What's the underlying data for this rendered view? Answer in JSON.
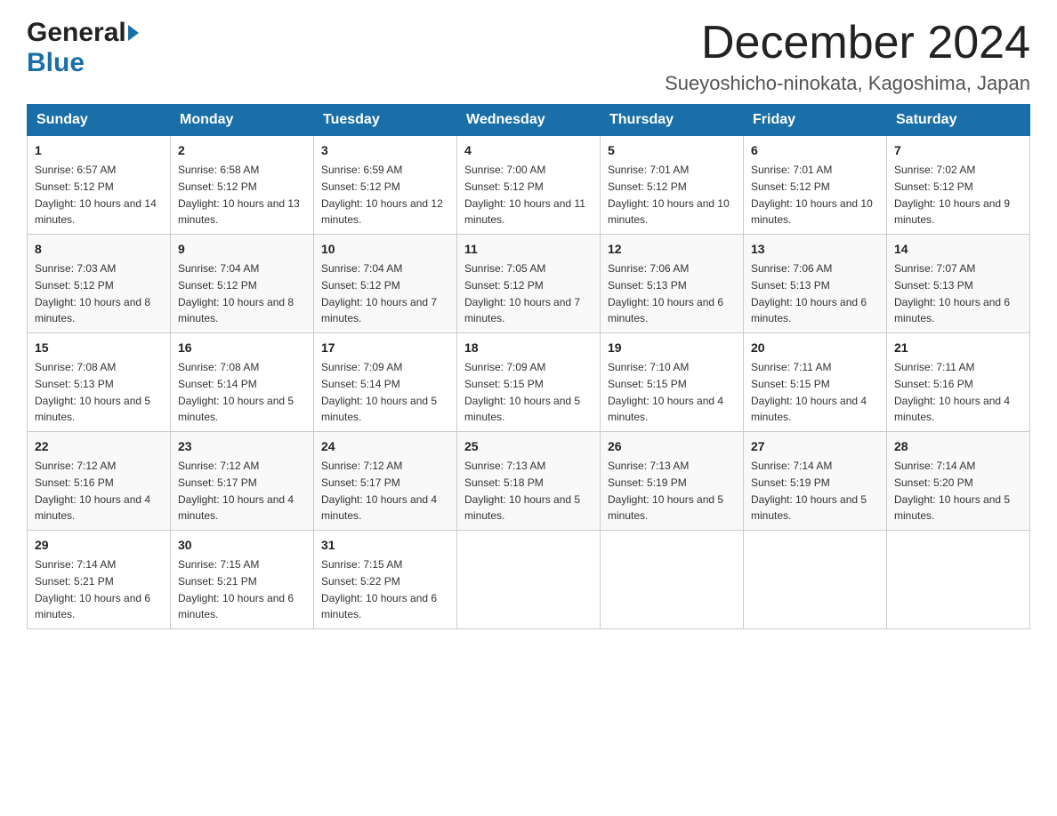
{
  "header": {
    "logo_general": "General",
    "logo_blue": "Blue",
    "month_title": "December 2024",
    "location": "Sueyoshicho-ninokata, Kagoshima, Japan"
  },
  "weekdays": [
    "Sunday",
    "Monday",
    "Tuesday",
    "Wednesday",
    "Thursday",
    "Friday",
    "Saturday"
  ],
  "weeks": [
    [
      {
        "day": "1",
        "sunrise": "6:57 AM",
        "sunset": "5:12 PM",
        "daylight": "10 hours and 14 minutes."
      },
      {
        "day": "2",
        "sunrise": "6:58 AM",
        "sunset": "5:12 PM",
        "daylight": "10 hours and 13 minutes."
      },
      {
        "day": "3",
        "sunrise": "6:59 AM",
        "sunset": "5:12 PM",
        "daylight": "10 hours and 12 minutes."
      },
      {
        "day": "4",
        "sunrise": "7:00 AM",
        "sunset": "5:12 PM",
        "daylight": "10 hours and 11 minutes."
      },
      {
        "day": "5",
        "sunrise": "7:01 AM",
        "sunset": "5:12 PM",
        "daylight": "10 hours and 10 minutes."
      },
      {
        "day": "6",
        "sunrise": "7:01 AM",
        "sunset": "5:12 PM",
        "daylight": "10 hours and 10 minutes."
      },
      {
        "day": "7",
        "sunrise": "7:02 AM",
        "sunset": "5:12 PM",
        "daylight": "10 hours and 9 minutes."
      }
    ],
    [
      {
        "day": "8",
        "sunrise": "7:03 AM",
        "sunset": "5:12 PM",
        "daylight": "10 hours and 8 minutes."
      },
      {
        "day": "9",
        "sunrise": "7:04 AM",
        "sunset": "5:12 PM",
        "daylight": "10 hours and 8 minutes."
      },
      {
        "day": "10",
        "sunrise": "7:04 AM",
        "sunset": "5:12 PM",
        "daylight": "10 hours and 7 minutes."
      },
      {
        "day": "11",
        "sunrise": "7:05 AM",
        "sunset": "5:12 PM",
        "daylight": "10 hours and 7 minutes."
      },
      {
        "day": "12",
        "sunrise": "7:06 AM",
        "sunset": "5:13 PM",
        "daylight": "10 hours and 6 minutes."
      },
      {
        "day": "13",
        "sunrise": "7:06 AM",
        "sunset": "5:13 PM",
        "daylight": "10 hours and 6 minutes."
      },
      {
        "day": "14",
        "sunrise": "7:07 AM",
        "sunset": "5:13 PM",
        "daylight": "10 hours and 6 minutes."
      }
    ],
    [
      {
        "day": "15",
        "sunrise": "7:08 AM",
        "sunset": "5:13 PM",
        "daylight": "10 hours and 5 minutes."
      },
      {
        "day": "16",
        "sunrise": "7:08 AM",
        "sunset": "5:14 PM",
        "daylight": "10 hours and 5 minutes."
      },
      {
        "day": "17",
        "sunrise": "7:09 AM",
        "sunset": "5:14 PM",
        "daylight": "10 hours and 5 minutes."
      },
      {
        "day": "18",
        "sunrise": "7:09 AM",
        "sunset": "5:15 PM",
        "daylight": "10 hours and 5 minutes."
      },
      {
        "day": "19",
        "sunrise": "7:10 AM",
        "sunset": "5:15 PM",
        "daylight": "10 hours and 4 minutes."
      },
      {
        "day": "20",
        "sunrise": "7:11 AM",
        "sunset": "5:15 PM",
        "daylight": "10 hours and 4 minutes."
      },
      {
        "day": "21",
        "sunrise": "7:11 AM",
        "sunset": "5:16 PM",
        "daylight": "10 hours and 4 minutes."
      }
    ],
    [
      {
        "day": "22",
        "sunrise": "7:12 AM",
        "sunset": "5:16 PM",
        "daylight": "10 hours and 4 minutes."
      },
      {
        "day": "23",
        "sunrise": "7:12 AM",
        "sunset": "5:17 PM",
        "daylight": "10 hours and 4 minutes."
      },
      {
        "day": "24",
        "sunrise": "7:12 AM",
        "sunset": "5:17 PM",
        "daylight": "10 hours and 4 minutes."
      },
      {
        "day": "25",
        "sunrise": "7:13 AM",
        "sunset": "5:18 PM",
        "daylight": "10 hours and 5 minutes."
      },
      {
        "day": "26",
        "sunrise": "7:13 AM",
        "sunset": "5:19 PM",
        "daylight": "10 hours and 5 minutes."
      },
      {
        "day": "27",
        "sunrise": "7:14 AM",
        "sunset": "5:19 PM",
        "daylight": "10 hours and 5 minutes."
      },
      {
        "day": "28",
        "sunrise": "7:14 AM",
        "sunset": "5:20 PM",
        "daylight": "10 hours and 5 minutes."
      }
    ],
    [
      {
        "day": "29",
        "sunrise": "7:14 AM",
        "sunset": "5:21 PM",
        "daylight": "10 hours and 6 minutes."
      },
      {
        "day": "30",
        "sunrise": "7:15 AM",
        "sunset": "5:21 PM",
        "daylight": "10 hours and 6 minutes."
      },
      {
        "day": "31",
        "sunrise": "7:15 AM",
        "sunset": "5:22 PM",
        "daylight": "10 hours and 6 minutes."
      },
      null,
      null,
      null,
      null
    ]
  ],
  "labels": {
    "sunrise_prefix": "Sunrise: ",
    "sunset_prefix": "Sunset: ",
    "daylight_prefix": "Daylight: "
  }
}
